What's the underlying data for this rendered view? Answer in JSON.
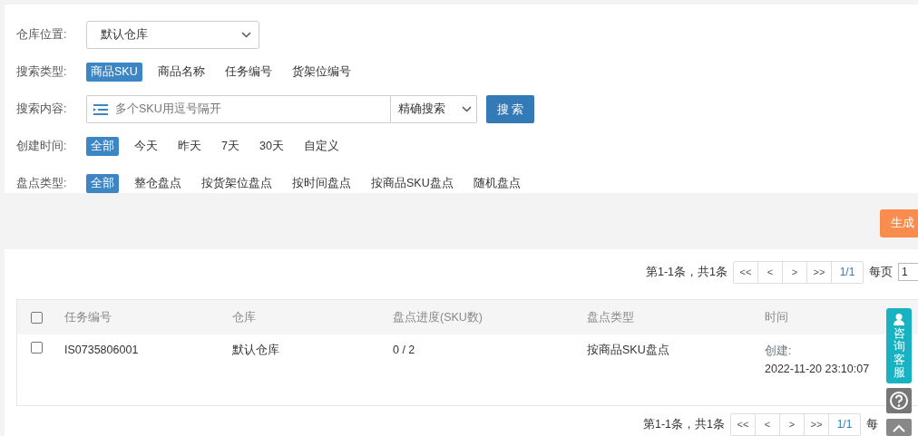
{
  "filters": {
    "warehouse": {
      "label": "仓库位置:",
      "value": "默认仓库"
    },
    "search_type": {
      "label": "搜索类型:",
      "options": [
        {
          "label": "商品SKU",
          "selected": true
        },
        {
          "label": "商品名称",
          "selected": false
        },
        {
          "label": "任务编号",
          "selected": false
        },
        {
          "label": "货架位编号",
          "selected": false
        }
      ]
    },
    "search_content": {
      "label": "搜索内容:",
      "placeholder": "多个SKU用逗号隔开",
      "mode": "精确搜索",
      "button": "搜 索"
    },
    "created_time": {
      "label": "创建时间:",
      "options": [
        {
          "label": "全部",
          "selected": true
        },
        {
          "label": "今天",
          "selected": false
        },
        {
          "label": "昨天",
          "selected": false
        },
        {
          "label": "7天",
          "selected": false
        },
        {
          "label": "30天",
          "selected": false
        },
        {
          "label": "自定义",
          "selected": false
        }
      ]
    },
    "check_type": {
      "label": "盘点类型:",
      "options": [
        {
          "label": "全部",
          "selected": true
        },
        {
          "label": "整仓盘点",
          "selected": false
        },
        {
          "label": "按货架位盘点",
          "selected": false
        },
        {
          "label": "按时间盘点",
          "selected": false
        },
        {
          "label": "按商品SKU盘点",
          "selected": false
        },
        {
          "label": "随机盘点",
          "selected": false
        }
      ]
    }
  },
  "generate_button": "生成",
  "pagination_top": {
    "summary": "第1-1条，共1条",
    "buttons": [
      "<<",
      "<",
      ">",
      ">>"
    ],
    "page": "1/1",
    "per_page_label": "每页",
    "per_page_value": "1"
  },
  "table": {
    "header_checked": false,
    "columns": [
      "任务编号",
      "仓库",
      "盘点进度(SKU数)",
      "盘点类型",
      "时间"
    ],
    "rows": [
      {
        "checked": false,
        "cells": [
          "IS0735806001",
          "默认仓库",
          "0 / 2",
          "按商品SKU盘点"
        ],
        "time_label": "创建:",
        "time_value": "2022-11-20 23:10:07"
      }
    ]
  },
  "pagination_bottom": {
    "summary": "第1-1条，共1条",
    "buttons": [
      "<<",
      "<",
      ">",
      ">>"
    ],
    "page": "1/1",
    "per_page_label": "每"
  },
  "consult_tab": "咨询客服"
}
